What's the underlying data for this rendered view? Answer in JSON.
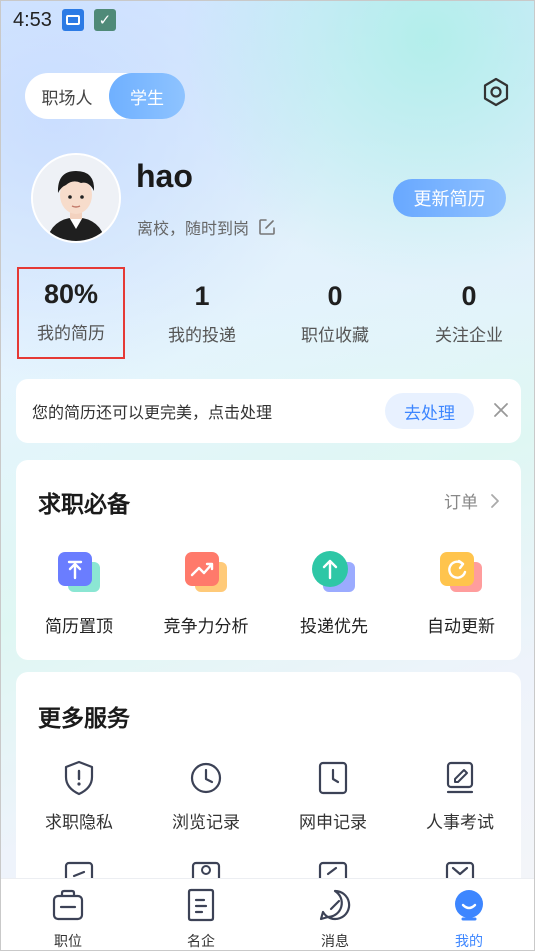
{
  "status_bar": {
    "time": "4:53",
    "icons": [
      "app-notification-icon",
      "check-app-icon"
    ]
  },
  "mode_toggle": {
    "options": [
      "职场人",
      "学生"
    ],
    "active": "学生"
  },
  "profile": {
    "username": "hao",
    "status": "离校，随时到岗",
    "update_button": "更新简历"
  },
  "stats": [
    {
      "value": "80%",
      "label": "我的简历"
    },
    {
      "value": "1",
      "label": "我的投递"
    },
    {
      "value": "0",
      "label": "职位收藏"
    },
    {
      "value": "0",
      "label": "关注企业"
    }
  ],
  "tip": {
    "text": "您的简历还可以更完美，点击处理",
    "action": "去处理"
  },
  "essentials": {
    "title": "求职必备",
    "orders_link": "订单",
    "items": [
      {
        "label": "简历置顶",
        "icon": "pin-top-icon",
        "color": "#6a7dff"
      },
      {
        "label": "竞争力分析",
        "icon": "trend-chart-icon",
        "color": "#ff7a6b"
      },
      {
        "label": "投递优先",
        "icon": "priority-up-icon",
        "color": "#2ec7a6"
      },
      {
        "label": "自动更新",
        "icon": "auto-refresh-icon",
        "color": "#ffb44d"
      }
    ]
  },
  "more_services": {
    "title": "更多服务",
    "items": [
      {
        "label": "求职隐私",
        "icon": "privacy-shield-icon"
      },
      {
        "label": "浏览记录",
        "icon": "clock-icon"
      },
      {
        "label": "网申记录",
        "icon": "application-record-icon"
      },
      {
        "label": "人事考试",
        "icon": "exam-book-icon"
      }
    ]
  },
  "bottom_nav": {
    "items": [
      {
        "label": "职位",
        "icon": "briefcase-icon"
      },
      {
        "label": "名企",
        "icon": "company-icon"
      },
      {
        "label": "消息",
        "icon": "message-icon"
      },
      {
        "label": "我的",
        "icon": "profile-icon"
      }
    ],
    "active": "我的",
    "accent": "#3d86ff"
  }
}
